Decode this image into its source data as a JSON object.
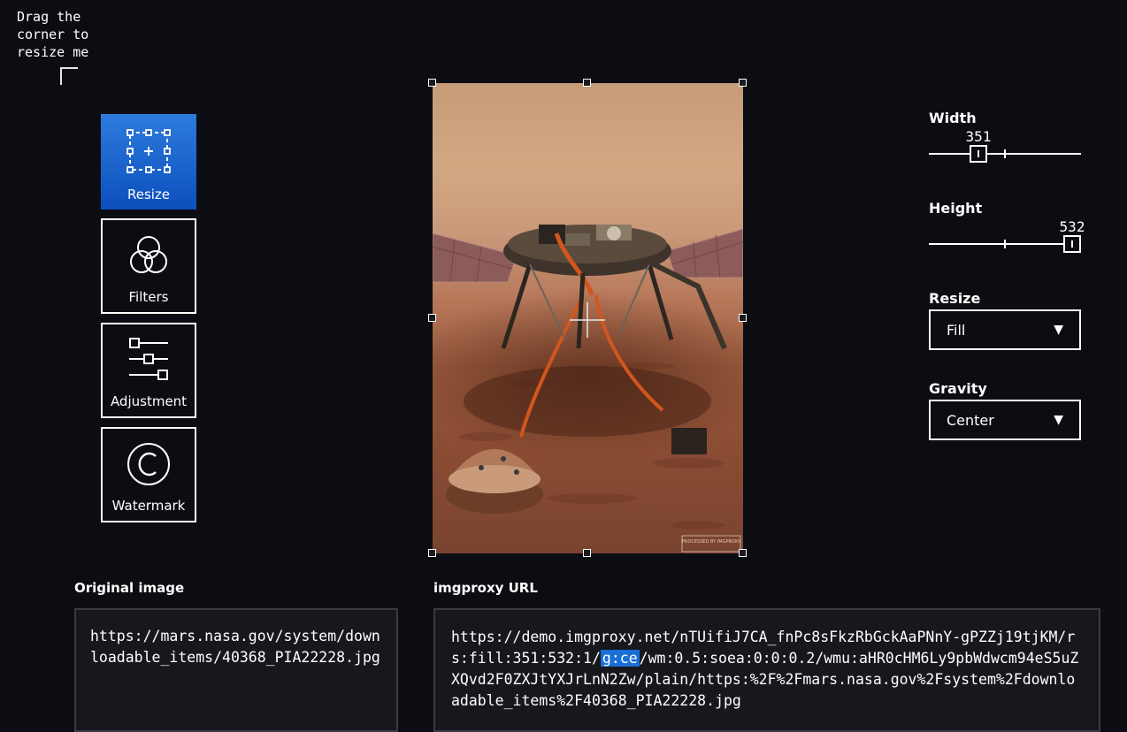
{
  "hint": {
    "text": "Drag the corner to resize me"
  },
  "tools": [
    {
      "label": "Resize",
      "icon": "resize-icon",
      "active": true
    },
    {
      "label": "Filters",
      "icon": "filters-icon",
      "active": false
    },
    {
      "label": "Adjustment",
      "icon": "adjustment-icon",
      "active": false
    },
    {
      "label": "Watermark",
      "icon": "watermark-icon",
      "active": false
    }
  ],
  "watermark_stamp": "PROCESSED BY IMGPROXY",
  "controls": {
    "width": {
      "label": "Width",
      "value": "351",
      "fraction": 0.33
    },
    "height": {
      "label": "Height",
      "value": "532",
      "fraction": 1.0
    },
    "resize": {
      "label": "Resize",
      "selected": "Fill"
    },
    "gravity": {
      "label": "Gravity",
      "selected": "Center"
    }
  },
  "original": {
    "title": "Original image",
    "url": "https://mars.nasa.gov/system/downloadable_items/40368_PIA22228.jpg"
  },
  "imgproxy": {
    "title": "imgproxy URL",
    "url_before": "https://demo.imgproxy.net/nTUifiJ7CA_fnPc8sFkzRbGckAaPNnY-gPZZj19tjKM/rs:fill:351:532:1/",
    "url_highlight": "g:ce",
    "url_after": "/wm:0.5:soea:0:0:0.2/wmu:aHR0cHM6Ly9pbWdwcm94eS5uZXQvd2F0ZXJtYXJrLnN2Zw/plain/https:%2F%2Fmars.nasa.gov%2Fsystem%2Fdownloadable_items%2F40368_PIA22228.jpg"
  },
  "colors": {
    "accent": "#1a6fd6",
    "background": "#0c0d12"
  }
}
